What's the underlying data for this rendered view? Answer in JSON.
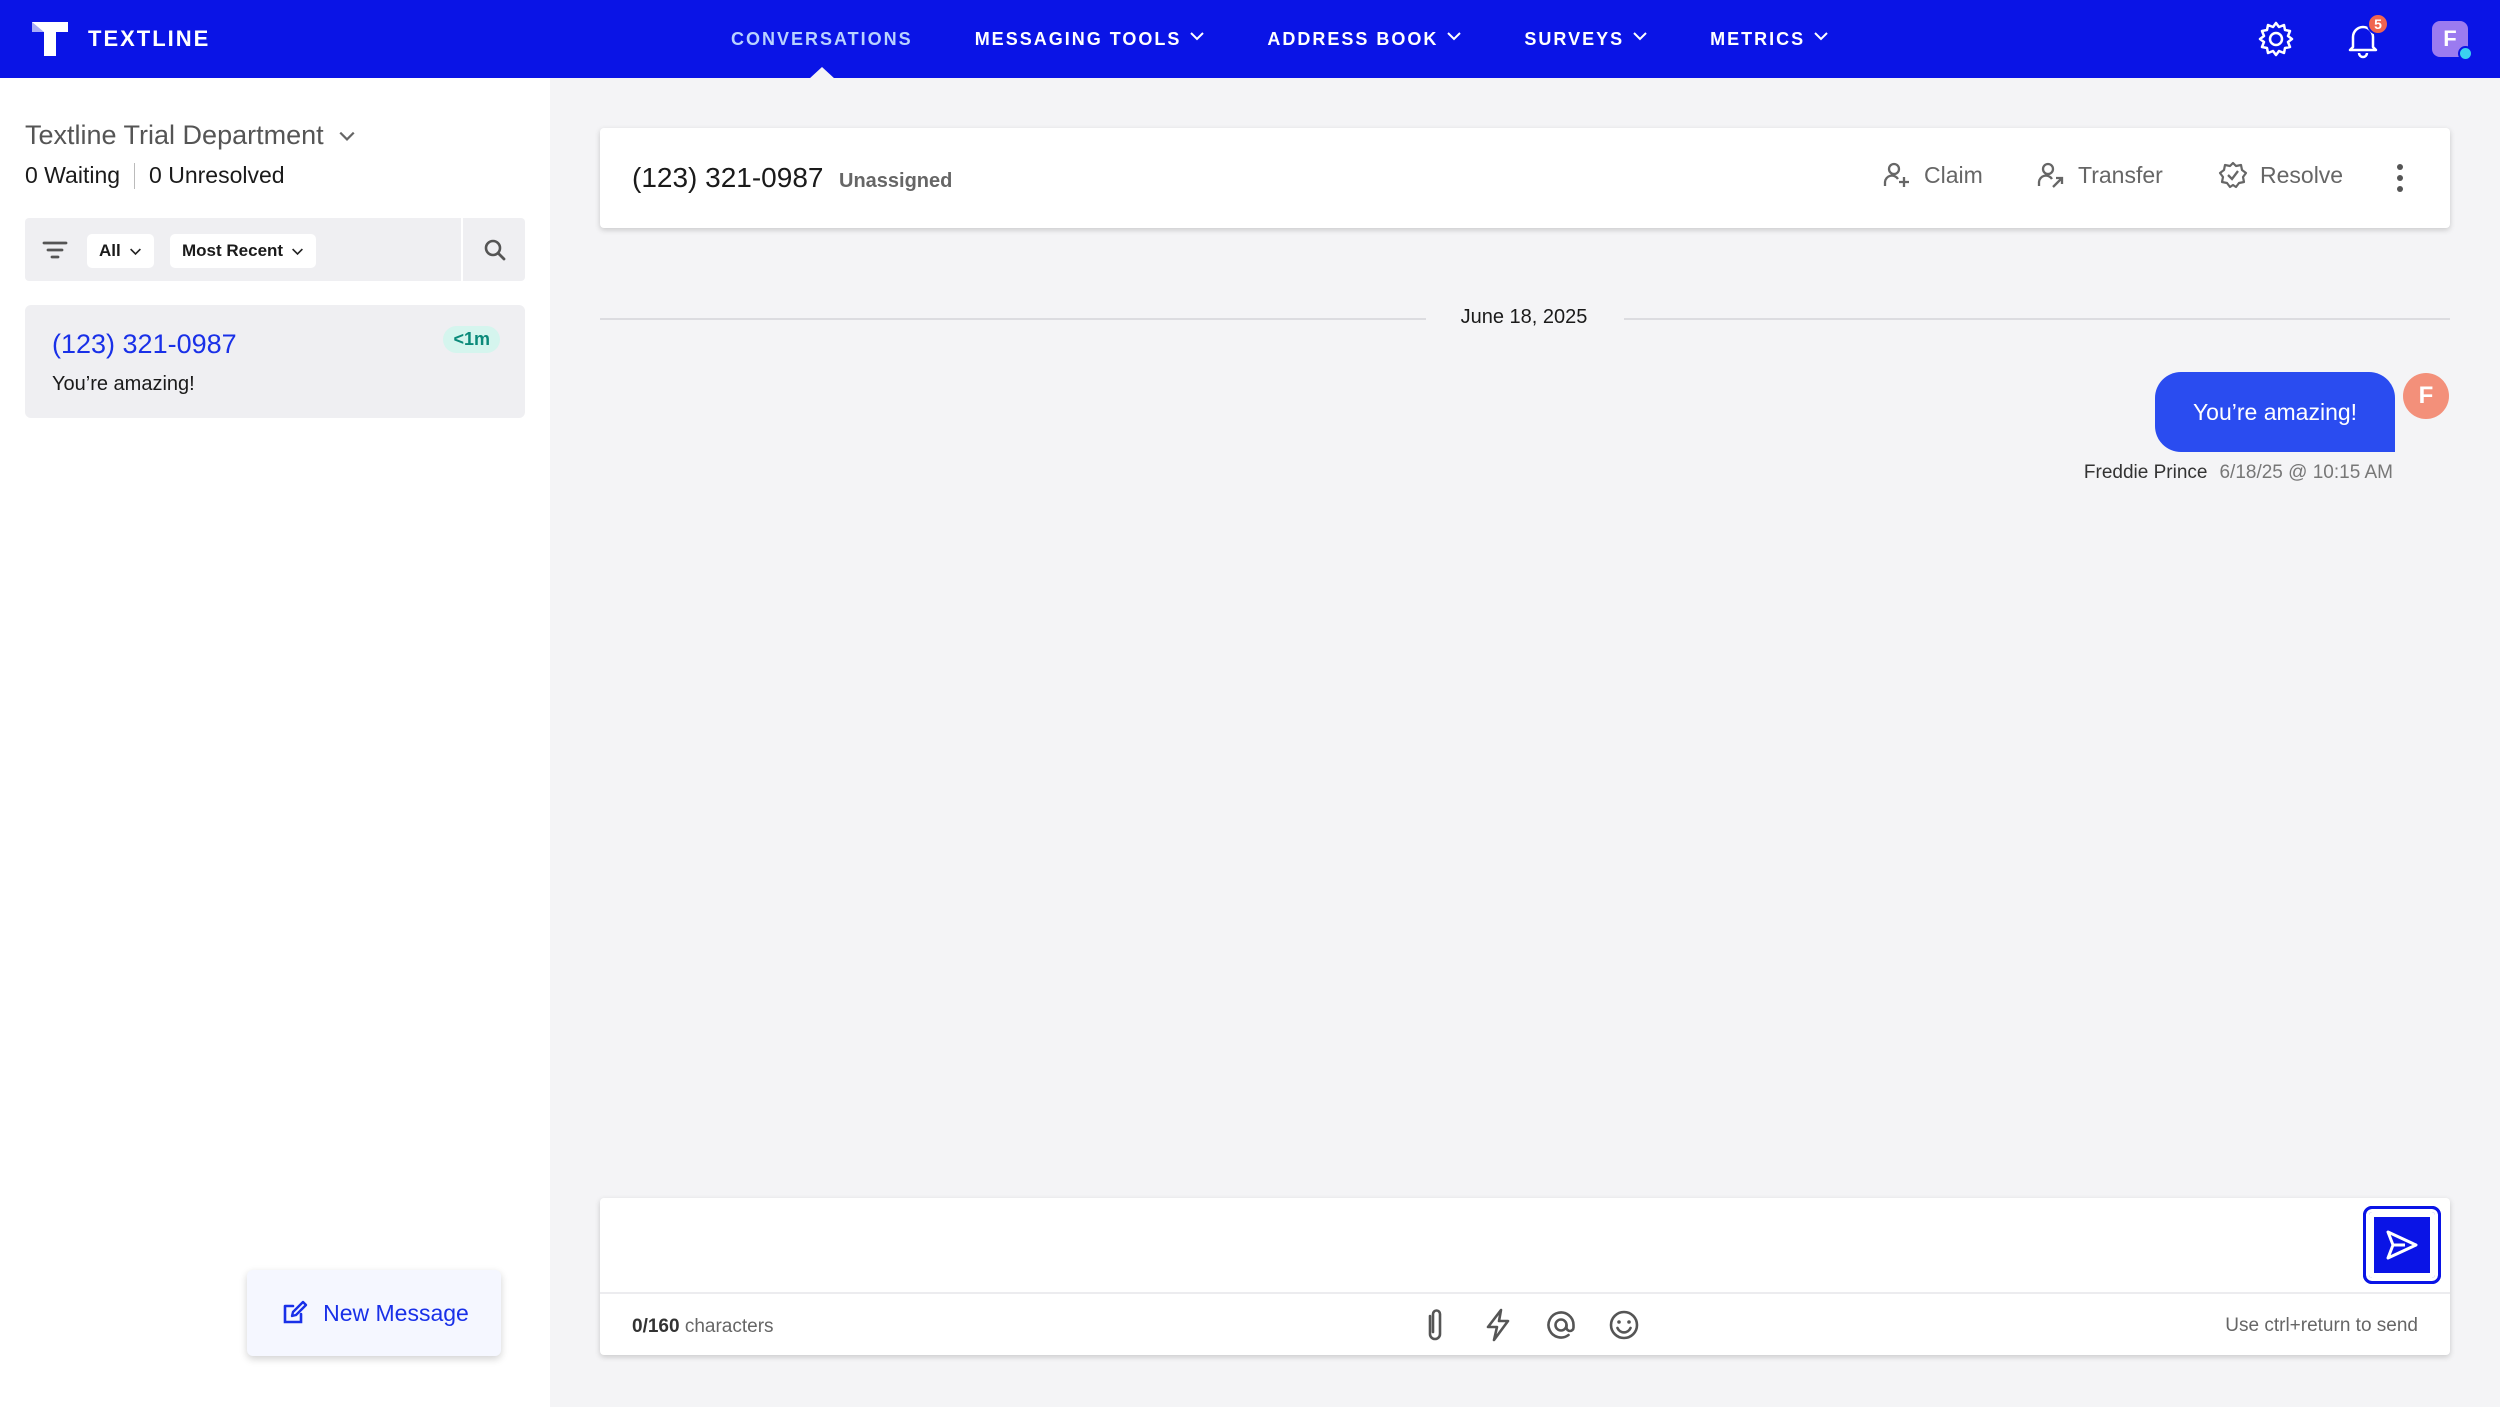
{
  "app": {
    "brand": "TEXTLINE",
    "nav": [
      {
        "label": "CONVERSATIONS",
        "active": true,
        "has_menu": false
      },
      {
        "label": "MESSAGING TOOLS",
        "active": false,
        "has_menu": true
      },
      {
        "label": "ADDRESS BOOK",
        "active": false,
        "has_menu": true
      },
      {
        "label": "SURVEYS",
        "active": false,
        "has_menu": true
      },
      {
        "label": "METRICS",
        "active": false,
        "has_menu": true
      }
    ],
    "notifications_count": "5",
    "user_initial": "F",
    "colors": {
      "nav_bg": "#0a14e6",
      "accent": "#2a4cf0",
      "badge": "#f0654f",
      "avatar": "#9b7bf0",
      "presence": "#3ad1f0"
    }
  },
  "sidebar": {
    "department": "Textline Trial Department",
    "waiting": "0 Waiting",
    "unresolved": "0 Unresolved",
    "filter_all": "All",
    "filter_sort": "Most Recent",
    "conversations": [
      {
        "phone": "(123) 321-0987",
        "time": "<1m",
        "snippet": "You’re amazing!"
      }
    ],
    "new_message_label": "New Message"
  },
  "conversation": {
    "phone": "(123) 321-0987",
    "status": "Unassigned",
    "actions": {
      "claim": "Claim",
      "transfer": "Transfer",
      "resolve": "Resolve"
    },
    "date_divider": "June 18, 2025",
    "messages": [
      {
        "text": "You’re amazing!",
        "sender": "Freddie Prince",
        "timestamp": "6/18/25 @ 10:15 AM",
        "avatar_initial": "F",
        "direction": "outgoing"
      }
    ]
  },
  "composer": {
    "value": "",
    "char_count": "0/160",
    "char_suffix": " characters",
    "hint": "Use ctrl+return to send",
    "tools": [
      "attachment-icon",
      "lightning-icon",
      "mention-icon",
      "emoji-icon"
    ]
  }
}
